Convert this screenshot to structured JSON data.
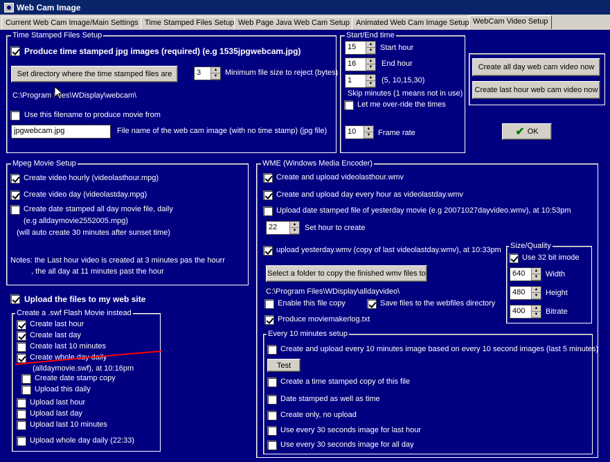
{
  "window": {
    "title": "Web Cam Image"
  },
  "tabs": [
    "Current Web Cam Image/Main Settings",
    "Time Stamped Files Setup",
    "Web Page Java Web Cam Setup",
    "Animated Web Cam Image Setup",
    "WebCam Video Setup"
  ],
  "tsf": {
    "group": "Time Stamped Files Setup",
    "produce": "Produce time stamped jpg images (required) (e.g 1535jpgwebcam.jpg)",
    "set_dir": "Set directory where the time stamped files are",
    "min_size_value": "3",
    "min_size_label": "Minimum file size to reject (bytes)",
    "path": "C:\\Program Files\\WDisplay\\webcam\\",
    "use_filename": "Use this filename to produce movie from",
    "filename_value": "jpgwebcam.jpg",
    "filename_label": "File name of the web cam image (with no time stamp) (jpg file)"
  },
  "se": {
    "group": "Start/End time",
    "start_value": "15",
    "start_label": "Start hour",
    "end_value": "16",
    "end_label": "End hour",
    "skip_value": "1",
    "skip_hint": "(5, 10,15,30)",
    "skip_label": "Skip minutes (1 means not in use)",
    "override": "Let me over-ride the times",
    "frame_value": "10",
    "frame_label": "Frame rate"
  },
  "actions": {
    "all_day": "Create all day web cam video now",
    "last_hour": "Create last hour web cam video now",
    "ok": "OK"
  },
  "mpeg": {
    "group": "Mpeg Movie Setup",
    "hourly": "Create video hourly (videolasthour.mpg)",
    "day": "Create video day  (videolastday.mpg)",
    "date_stamped": "Create date stamped all day movie file, daily",
    "eg": "(e.g alldaymovie2552005.mpg)",
    "auto": "(will auto create 30 minutes after sunset time)",
    "note1": "Notes: the Last hour video is created at 3 minutes pas the hourr",
    "note2": ", the all day at 11 minutes past the hour"
  },
  "upload": {
    "label": "Upload the files to my web site",
    "swf_group": "Create a .swf Flash Movie instead",
    "last_hour": "Create last hour",
    "last_day": "Create last day",
    "last_10": "Create last 10 minutes",
    "whole_day": "Create whole day daily",
    "whole_day_note": "(alldaymovie.swf), at 10:16pm",
    "date_stamp": "Create date stamp copy",
    "upload_daily": "Upload this daily",
    "up_last_hour": "Upload last hour",
    "up_last_day": "Upload last day",
    "up_last_10": "Upload last 10 minutes",
    "up_whole_day": "Upload whole day daily (22:33)"
  },
  "wme": {
    "group": "WME (Windows Media Encoder)",
    "last_hour": "Create and upload videolasthour.wmv",
    "every_hour": "Create and upload day every hour as videolastday.wmv",
    "yesterday": "Upload date stamped file of yesterday movie (e.g 20071027dayvideo.wmv), at 10:53pm",
    "hour_value": "22",
    "hour_label": "Set hour to create",
    "upload_yesterday": "upload yesterday.wmv (copy of last videolastday.wmv), at 10:33pm",
    "select_folder": "Select a folder to copy the finished wmv files to",
    "folder_path": "C:\\Program Files\\WDisplay\\alldayvideo\\",
    "enable_copy": "Enable this file copy",
    "save_webfiles": "Save files to the webfiles directory",
    "moviemaker": "Produce moviemakerlog.txt"
  },
  "size": {
    "group": "Size/Quality",
    "use32": "Use 32 bit imode",
    "width_value": "640",
    "width_label": "Width",
    "height_value": "480",
    "height_label": "Height",
    "bitrate_value": "400",
    "bitrate_label": "Bitrate"
  },
  "every10": {
    "group": "Every 10 minutes setup",
    "create_upload": "Create and upload every 10 minutes image based on every 10 second images (last 5 minutes)",
    "test": "Test",
    "ts_copy": "Create a time stamped copy of this file",
    "date_time": "Date stamped as well as time",
    "only": "Create only, no upload",
    "s30_hour": "Use every 30 seconds image for last hour",
    "s30_day": "Use every 30 seconds image for all day"
  },
  "colors": {
    "background": "#000080",
    "annotation": "#ff0000"
  }
}
